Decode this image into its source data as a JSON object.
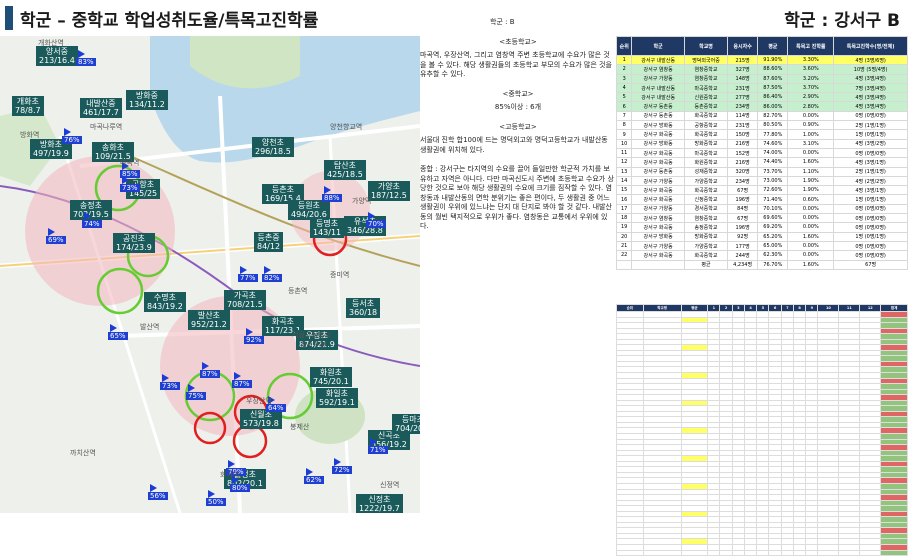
{
  "header": {
    "title": "학군 – 중학교 학업성취도율/특목고진학률",
    "district": "학군 : 강서구 B"
  },
  "colors": {
    "label_bg": "#1a5a5a",
    "pct_bg": "#1e3fd0",
    "header_bar": "#1f4e79",
    "table_head": "#1f3864",
    "highlight_yellow": "#ffff66",
    "highlight_green": "#c6efce",
    "circle_red": "#e02020",
    "circle_green": "#66cc33"
  },
  "map": {
    "schools": [
      {
        "name": "양서중",
        "val": "213/16.4"
      },
      {
        "name": "내발산중",
        "val": "461/17.7"
      },
      {
        "name": "개화초",
        "val": "78/8.7"
      },
      {
        "name": "방화중",
        "val": "134/11.2"
      },
      {
        "name": "방화초",
        "val": "497/19.9"
      },
      {
        "name": "송화초",
        "val": "109/21.5"
      },
      {
        "name": "공항초",
        "val": "145/25"
      },
      {
        "name": "송정초",
        "val": "703/19.5"
      },
      {
        "name": "공진초",
        "val": "174/23.9"
      },
      {
        "name": "양천초",
        "val": "296/18.5"
      },
      {
        "name": "등촌초",
        "val": "169/15.4"
      },
      {
        "name": "등원초",
        "val": "494/20.6"
      },
      {
        "name": "등명초",
        "val": "143/11"
      },
      {
        "name": "등촌중",
        "val": "84/12"
      },
      {
        "name": "탑산초",
        "val": "425/18.5"
      },
      {
        "name": "가양초",
        "val": "187/12.5"
      },
      {
        "name": "유석초",
        "val": "346/28.8"
      },
      {
        "name": "가곡초",
        "val": "708/21.5"
      },
      {
        "name": "수명초",
        "val": "843/19.2"
      },
      {
        "name": "발산초",
        "val": "952/21.2"
      },
      {
        "name": "화곡초",
        "val": "117/23.1"
      },
      {
        "name": "백석초",
        "val": "823/21.1"
      },
      {
        "name": "영종초",
        "val": "828/20.7"
      },
      {
        "name": "등서초",
        "val": "360/18"
      },
      {
        "name": "우장초",
        "val": "874/21.9"
      },
      {
        "name": "등현초",
        "val": "439/19.1"
      },
      {
        "name": "경명초",
        "val": "872/22.4"
      },
      {
        "name": "화원초",
        "val": "745/20.1"
      },
      {
        "name": "화일초",
        "val": "592/19.1"
      },
      {
        "name": "신월초",
        "val": "573/19.8"
      },
      {
        "name": "신곡초",
        "val": "556/19.2"
      },
      {
        "name": "등마초",
        "val": "704/20.1"
      },
      {
        "name": "월정초",
        "val": "802/20.1"
      },
      {
        "name": "신정초",
        "val": "1222/19.7"
      }
    ],
    "pcts": [
      "83%",
      "76%",
      "85%",
      "88%",
      "73%",
      "70%",
      "74%",
      "69%",
      "82%",
      "77%",
      "65%",
      "92%",
      "87%",
      "87%",
      "86%",
      "75%",
      "73%",
      "64%",
      "79%",
      "71%",
      "72%",
      "62%",
      "80%",
      "82%",
      "56%",
      "50%",
      "95%",
      "96%"
    ],
    "places": [
      "개화산역",
      "방화역",
      "마곡나루역",
      "마곡역",
      "발산역",
      "우장산역",
      "화곡역",
      "까치산역",
      "양천향교역",
      "가양역",
      "증미역",
      "등촌역",
      "염창역",
      "신정역",
      "강서구청",
      "서울고등학교",
      "봉제산"
    ]
  },
  "middle": {
    "school_label": "학군 : B",
    "elem_head": "<초등학교>",
    "elem_text": "마곡역, 우장산역, 그리고 염창역 주변 초등학교에 수요가 많은 것을 볼 수 있다. 해당 생활권들의 초등학교 부모의 수요가 많은 것을 유추할 수 있다.",
    "mid_head": "<중학교>",
    "mid_text": "85%이상 : 6개",
    "high_head": "<고등학교>",
    "high_text": "서울대 진학 합100에 드는 명덕외고와 명덕고등학교가 내발산동 생활권에 위치해 있다.",
    "summary": "종합 : 강서구는 타지역의 수요를 끌어 들일만한 학군적 가치를 보유하고 자역은 아니다. 다만 마곡신도시 주변에 초등학교 수요가 상당한 것으로 보아 해당 생활권의 수요에 크기를 짐작할 수 있다. 염창동과 내발산동의 면학 분위기는 좋은 편이다, 두 생활권 중 어느 생활권이 우위에 있느냐는 단지 대 단지로 봐야 할 것 같다. 내발산동의 월빈 택지적으로 우위가 좋다. 염창동은 교통에서 우위에 있다."
  },
  "table1": {
    "headers": [
      "순위",
      "학군",
      "학교명",
      "응시자수",
      "평균",
      "특목고 진학률",
      "특목고진학수(명/전체)"
    ],
    "rows": [
      [
        "1",
        "강서구 내발산동",
        "명덕외국어중",
        "215명",
        "91.90%",
        "3.30%",
        "4명 (3명/6명)"
      ],
      [
        "2",
        "강서구 염창동",
        "염창중학교",
        "327명",
        "88.60%",
        "3.60%",
        "10명 (5명/4명)"
      ],
      [
        "3",
        "강서구 가양동",
        "염창중학교",
        "148명",
        "87.60%",
        "3.20%",
        "4명 (3명/4명)"
      ],
      [
        "4",
        "강서구 내발산동",
        "마곡중학교",
        "231명",
        "87.50%",
        "3.70%",
        "7명 (3명/4명)"
      ],
      [
        "5",
        "강서구 내발산동",
        "신원중학교",
        "277명",
        "86.40%",
        "2.90%",
        "4명 (3명/4명)"
      ],
      [
        "6",
        "강서구 등촌동",
        "등촌중학교",
        "234명",
        "86.00%",
        "2.80%",
        "4명 (3명/4명)"
      ],
      [
        "7",
        "강서구 등촌동",
        "화곡중학교",
        "114명",
        "82.70%",
        "0.00%",
        "0명 (0명/0명)"
      ],
      [
        "8",
        "강서구 방화동",
        "공항중학교",
        "231명",
        "80.50%",
        "0.90%",
        "2명 (1명/1명)"
      ],
      [
        "9",
        "강서구 화곡동",
        "화곡중학교",
        "150명",
        "77.80%",
        "1.00%",
        "1명 (0명/1명)"
      ],
      [
        "10",
        "강서구 방화동",
        "방화중학교",
        "216명",
        "74.60%",
        "3.10%",
        "4명 (3명/2명)"
      ],
      [
        "11",
        "강서구 화곡동",
        "마곡중학교",
        "152명",
        "74.00%",
        "0.00%",
        "0명 (0명/0명)"
      ],
      [
        "12",
        "강서구 화곡동",
        "화원중학교",
        "216명",
        "74.40%",
        "1.60%",
        "4명 (3명/1명)"
      ],
      [
        "13",
        "강서구 등촌동",
        "성재중학교",
        "320명",
        "73.70%",
        "1.10%",
        "2명 (1명/1명)"
      ],
      [
        "14",
        "강서구 가양동",
        "가양중학교",
        "234명",
        "73.00%",
        "1.90%",
        "4명 (2명/2명)"
      ],
      [
        "15",
        "강서구 화곡동",
        "화곡중학교",
        "67명",
        "72.60%",
        "1.90%",
        "4명 (3명/1명)"
      ],
      [
        "16",
        "강서구 화곡동",
        "신정중학교",
        "196명",
        "71.40%",
        "0.60%",
        "1명 (0명/1명)"
      ],
      [
        "17",
        "강서구 가양동",
        "경서중학교",
        "84명",
        "70.10%",
        "0.00%",
        "0명 (0명/0명)"
      ],
      [
        "18",
        "강서구 염창동",
        "염창중학교",
        "67명",
        "69.60%",
        "0.00%",
        "0명 (0명/0명)"
      ],
      [
        "19",
        "강서구 화곡동",
        "송정중학교",
        "196명",
        "69.20%",
        "0.00%",
        "0명 (0명/0명)"
      ],
      [
        "20",
        "강서구 방화동",
        "방화중학교",
        "92명",
        "65.20%",
        "1.60%",
        "1명 (0명/1명)"
      ],
      [
        "21",
        "강서구 가양동",
        "가양중학교",
        "177명",
        "65.00%",
        "0.00%",
        "0명 (0명/0명)"
      ],
      [
        "22",
        "강서구 화곡동",
        "화곡중학교",
        "244명",
        "62.30%",
        "0.00%",
        "0명 (0명/0명)"
      ],
      [
        "",
        "",
        "평균",
        "4,234명",
        "76.70%",
        "1.60%",
        "67명"
      ]
    ]
  },
  "table2": {
    "headers": [
      "순위",
      "학교명",
      "평균",
      "1",
      "2",
      "3",
      "4",
      "5",
      "6",
      "7",
      "8",
      "9",
      "10",
      "11",
      "12",
      "합계"
    ],
    "row_count": 44
  }
}
